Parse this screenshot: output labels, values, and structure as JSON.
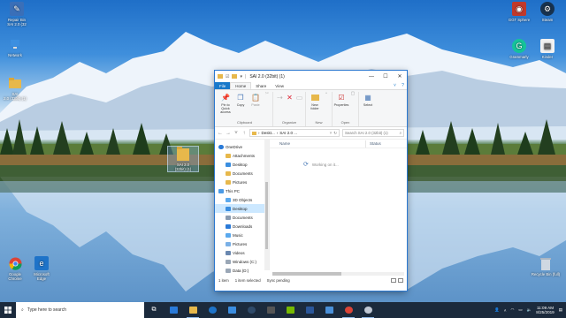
{
  "desktop": {
    "icons_left": [
      {
        "label": "Recycle Bin\nSAI 2.0 (32bit)",
        "lines": [
          "Repair Bin",
          "SAI 2.0 (32"
        ]
      },
      {
        "label": "Network"
      },
      {
        "label": "SAI 2.0 (32bit) (1)"
      }
    ],
    "top_left_icon_label_1": "Repair Bin",
    "top_left_icon_label_2": "SAI 2.0 (32",
    "network_label": "Network",
    "sai_small_label_1": "SAI",
    "sai_small_label_2": "2.0 (32bit) (1)",
    "sai_folder_label_1": "SAI 2.0",
    "sai_folder_label_2": "(32bit) (1)",
    "chrome_label_1": "Google",
    "chrome_label_2": "Chrome",
    "edge_label_1": "Microsoft",
    "edge_label_2": "Edge",
    "right_icons": [
      {
        "label": "GGT Sphere"
      },
      {
        "label": "Steam"
      },
      {
        "label": "Grammarly"
      },
      {
        "label": "Kinder"
      },
      {
        "label": "Recycle Bin (full)"
      }
    ],
    "ggt_label": "GGT Sphere",
    "steam_label": "Steam",
    "grammarly_label": "Grammarly",
    "kinder_label": "Kinder",
    "recycle_label": "Recycle Bin (full)"
  },
  "explorer": {
    "title": "SAI 2.0 (32bit) (1)",
    "tabs": {
      "file": "File",
      "home": "Home",
      "share": "Share",
      "view": "View"
    },
    "ribbon": {
      "pin": "Pin to Quick access",
      "copy": "Copy",
      "paste": "Paste",
      "clipboard": "Clipboard",
      "organize": "Organize",
      "new_folder": "New folder",
      "new": "New",
      "properties": "Properties",
      "open": "Open",
      "select": "Select"
    },
    "address": {
      "part1": "Deskt...",
      "part2": "SAI 2.0 ...",
      "search_placeholder": "Search SAI 2.0 (32bit) (1)"
    },
    "nav": {
      "onedrive": "OneDrive",
      "attachments": "Attachments",
      "desktop1": "Desktop",
      "documents1": "Documents",
      "pictures1": "Pictures",
      "thispc": "This PC",
      "objects3d": "3D Objects",
      "desktop2": "Desktop",
      "documents2": "Documents",
      "downloads": "Downloads",
      "music": "Music",
      "pictures2": "Pictures",
      "videos": "Videos",
      "windows_c": "Windows (C:)",
      "data_d": "Data (D:)"
    },
    "columns": {
      "name": "Name",
      "status": "Status"
    },
    "working": "Working on it...",
    "status": {
      "items": "1 item",
      "selected": "1 item selected",
      "sync": "Sync pending"
    }
  },
  "taskbar": {
    "search_placeholder": "Type here to search",
    "time": "11:09 AM",
    "date": "8/25/2019"
  },
  "colors": {
    "accent": "#1979ca",
    "taskbar": "#1b2a3c",
    "selection": "#cce8ff"
  }
}
